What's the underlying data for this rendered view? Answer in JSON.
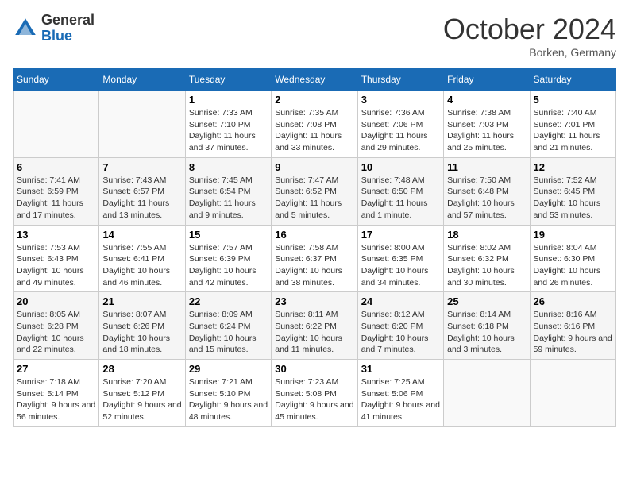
{
  "header": {
    "logo_general": "General",
    "logo_blue": "Blue",
    "month_title": "October 2024",
    "location": "Borken, Germany"
  },
  "weekdays": [
    "Sunday",
    "Monday",
    "Tuesday",
    "Wednesday",
    "Thursday",
    "Friday",
    "Saturday"
  ],
  "weeks": [
    [
      {
        "day": "",
        "info": ""
      },
      {
        "day": "",
        "info": ""
      },
      {
        "day": "1",
        "info": "Sunrise: 7:33 AM\nSunset: 7:10 PM\nDaylight: 11 hours and 37 minutes."
      },
      {
        "day": "2",
        "info": "Sunrise: 7:35 AM\nSunset: 7:08 PM\nDaylight: 11 hours and 33 minutes."
      },
      {
        "day": "3",
        "info": "Sunrise: 7:36 AM\nSunset: 7:06 PM\nDaylight: 11 hours and 29 minutes."
      },
      {
        "day": "4",
        "info": "Sunrise: 7:38 AM\nSunset: 7:03 PM\nDaylight: 11 hours and 25 minutes."
      },
      {
        "day": "5",
        "info": "Sunrise: 7:40 AM\nSunset: 7:01 PM\nDaylight: 11 hours and 21 minutes."
      }
    ],
    [
      {
        "day": "6",
        "info": "Sunrise: 7:41 AM\nSunset: 6:59 PM\nDaylight: 11 hours and 17 minutes."
      },
      {
        "day": "7",
        "info": "Sunrise: 7:43 AM\nSunset: 6:57 PM\nDaylight: 11 hours and 13 minutes."
      },
      {
        "day": "8",
        "info": "Sunrise: 7:45 AM\nSunset: 6:54 PM\nDaylight: 11 hours and 9 minutes."
      },
      {
        "day": "9",
        "info": "Sunrise: 7:47 AM\nSunset: 6:52 PM\nDaylight: 11 hours and 5 minutes."
      },
      {
        "day": "10",
        "info": "Sunrise: 7:48 AM\nSunset: 6:50 PM\nDaylight: 11 hours and 1 minute."
      },
      {
        "day": "11",
        "info": "Sunrise: 7:50 AM\nSunset: 6:48 PM\nDaylight: 10 hours and 57 minutes."
      },
      {
        "day": "12",
        "info": "Sunrise: 7:52 AM\nSunset: 6:45 PM\nDaylight: 10 hours and 53 minutes."
      }
    ],
    [
      {
        "day": "13",
        "info": "Sunrise: 7:53 AM\nSunset: 6:43 PM\nDaylight: 10 hours and 49 minutes."
      },
      {
        "day": "14",
        "info": "Sunrise: 7:55 AM\nSunset: 6:41 PM\nDaylight: 10 hours and 46 minutes."
      },
      {
        "day": "15",
        "info": "Sunrise: 7:57 AM\nSunset: 6:39 PM\nDaylight: 10 hours and 42 minutes."
      },
      {
        "day": "16",
        "info": "Sunrise: 7:58 AM\nSunset: 6:37 PM\nDaylight: 10 hours and 38 minutes."
      },
      {
        "day": "17",
        "info": "Sunrise: 8:00 AM\nSunset: 6:35 PM\nDaylight: 10 hours and 34 minutes."
      },
      {
        "day": "18",
        "info": "Sunrise: 8:02 AM\nSunset: 6:32 PM\nDaylight: 10 hours and 30 minutes."
      },
      {
        "day": "19",
        "info": "Sunrise: 8:04 AM\nSunset: 6:30 PM\nDaylight: 10 hours and 26 minutes."
      }
    ],
    [
      {
        "day": "20",
        "info": "Sunrise: 8:05 AM\nSunset: 6:28 PM\nDaylight: 10 hours and 22 minutes."
      },
      {
        "day": "21",
        "info": "Sunrise: 8:07 AM\nSunset: 6:26 PM\nDaylight: 10 hours and 18 minutes."
      },
      {
        "day": "22",
        "info": "Sunrise: 8:09 AM\nSunset: 6:24 PM\nDaylight: 10 hours and 15 minutes."
      },
      {
        "day": "23",
        "info": "Sunrise: 8:11 AM\nSunset: 6:22 PM\nDaylight: 10 hours and 11 minutes."
      },
      {
        "day": "24",
        "info": "Sunrise: 8:12 AM\nSunset: 6:20 PM\nDaylight: 10 hours and 7 minutes."
      },
      {
        "day": "25",
        "info": "Sunrise: 8:14 AM\nSunset: 6:18 PM\nDaylight: 10 hours and 3 minutes."
      },
      {
        "day": "26",
        "info": "Sunrise: 8:16 AM\nSunset: 6:16 PM\nDaylight: 9 hours and 59 minutes."
      }
    ],
    [
      {
        "day": "27",
        "info": "Sunrise: 7:18 AM\nSunset: 5:14 PM\nDaylight: 9 hours and 56 minutes."
      },
      {
        "day": "28",
        "info": "Sunrise: 7:20 AM\nSunset: 5:12 PM\nDaylight: 9 hours and 52 minutes."
      },
      {
        "day": "29",
        "info": "Sunrise: 7:21 AM\nSunset: 5:10 PM\nDaylight: 9 hours and 48 minutes."
      },
      {
        "day": "30",
        "info": "Sunrise: 7:23 AM\nSunset: 5:08 PM\nDaylight: 9 hours and 45 minutes."
      },
      {
        "day": "31",
        "info": "Sunrise: 7:25 AM\nSunset: 5:06 PM\nDaylight: 9 hours and 41 minutes."
      },
      {
        "day": "",
        "info": ""
      },
      {
        "day": "",
        "info": ""
      }
    ]
  ]
}
